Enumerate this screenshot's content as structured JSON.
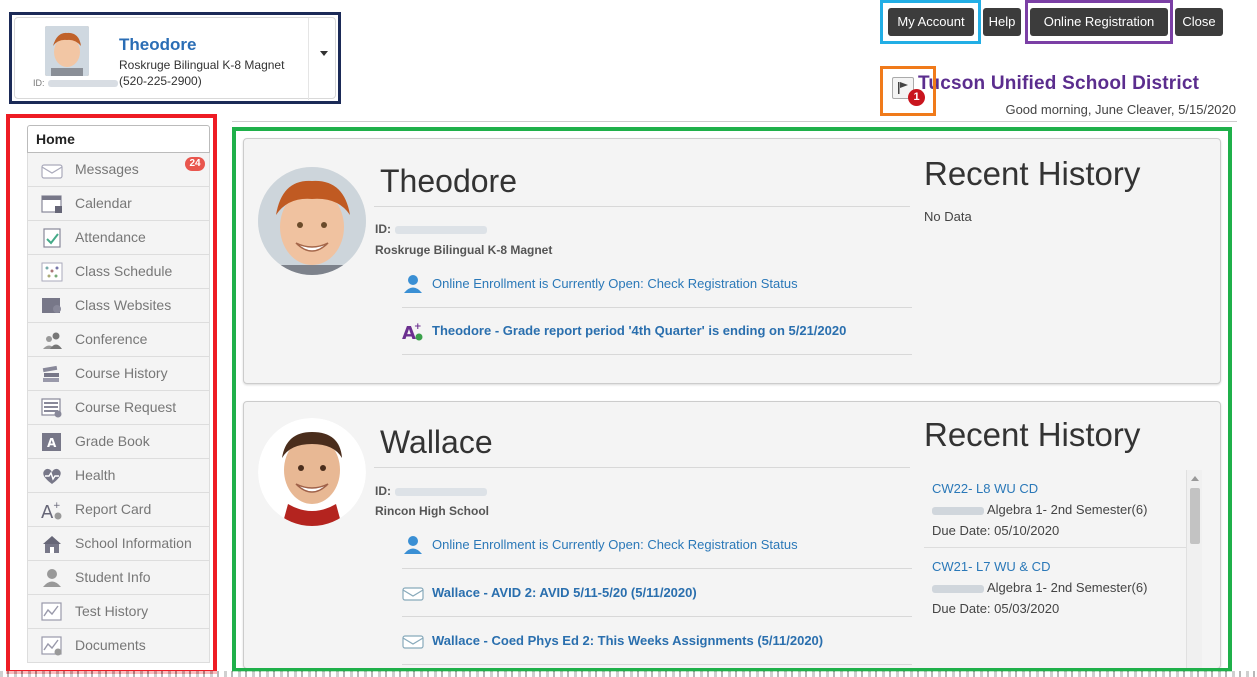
{
  "header": {
    "picker": {
      "name": "Theodore",
      "school": "Roskruge Bilingual K-8 Magnet",
      "phone": "(520-225-2900)",
      "id_label": "ID:"
    },
    "buttons": {
      "my_account": "My Account",
      "help": "Help",
      "online_registration": "Online Registration",
      "close": "Close"
    },
    "notification_count": "1",
    "district": "Tucson Unified School District",
    "greeting": "Good morning, June Cleaver, 5/15/2020"
  },
  "sidebar": {
    "home": "Home",
    "items": [
      {
        "label": "Messages",
        "icon": "messages-icon",
        "badge": "24"
      },
      {
        "label": "Calendar",
        "icon": "calendar-icon"
      },
      {
        "label": "Attendance",
        "icon": "attendance-icon"
      },
      {
        "label": "Class Schedule",
        "icon": "class-schedule-icon"
      },
      {
        "label": "Class Websites",
        "icon": "class-websites-icon"
      },
      {
        "label": "Conference",
        "icon": "conference-icon"
      },
      {
        "label": "Course History",
        "icon": "course-history-icon"
      },
      {
        "label": "Course Request",
        "icon": "course-request-icon"
      },
      {
        "label": "Grade Book",
        "icon": "grade-book-icon"
      },
      {
        "label": "Health",
        "icon": "health-icon"
      },
      {
        "label": "Report Card",
        "icon": "report-card-icon"
      },
      {
        "label": "School Information",
        "icon": "school-information-icon"
      },
      {
        "label": "Student Info",
        "icon": "student-info-icon"
      },
      {
        "label": "Test History",
        "icon": "test-history-icon"
      },
      {
        "label": "Documents",
        "icon": "documents-icon"
      }
    ]
  },
  "students": [
    {
      "name": "Theodore",
      "id_label": "ID:",
      "school": "Roskruge Bilingual K-8 Magnet",
      "notifications": [
        {
          "text": "Online Enrollment is Currently Open: Check Registration Status",
          "icon": "enrollment-icon"
        },
        {
          "text": "Theodore - Grade report period '4th Quarter' is ending on 5/21/2020",
          "icon": "grade-report-icon"
        }
      ],
      "recent_history_title": "Recent History",
      "recent_history_empty": "No Data"
    },
    {
      "name": "Wallace",
      "id_label": "ID:",
      "school": "Rincon High School",
      "notifications": [
        {
          "text": "Online Enrollment is Currently Open: Check Registration Status",
          "icon": "enrollment-icon"
        },
        {
          "text": "Wallace - AVID 2: AVID 5/11-5/20 (5/11/2020)",
          "icon": "message-icon"
        },
        {
          "text": "Wallace - Coed Phys Ed 2: This Weeks Assignments (5/11/2020)",
          "icon": "message-icon"
        }
      ],
      "recent_history_title": "Recent History",
      "recent_history": [
        {
          "code": "CW22- L8 WU CD",
          "course": "Algebra 1- 2nd Semester(6)",
          "due": "Due Date: 05/10/2020"
        },
        {
          "code": "CW21- L7 WU & CD",
          "course": "Algebra 1- 2nd Semester(6)",
          "due": "Due Date: 05/03/2020"
        }
      ]
    }
  ]
}
